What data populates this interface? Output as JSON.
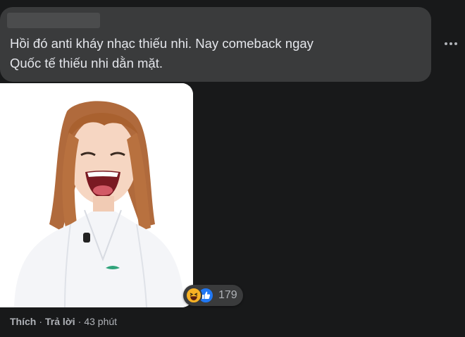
{
  "comment": {
    "text": "Hồi đó anti kháy nhạc thiếu nhi. Nay comeback ngay\nQuốc tế thiếu nhi dằn mặt.",
    "more_icon": "more-horizontal-icon"
  },
  "reactions": {
    "icons": [
      "haha-icon",
      "like-icon"
    ],
    "count": "179"
  },
  "actions": {
    "like_label": "Thích",
    "reply_label": "Trả lời",
    "separator": "·",
    "time": "43 phút"
  },
  "colors": {
    "background": "#18191a",
    "bubble": "#3a3b3c",
    "text": "#e4e6eb",
    "muted": "#b0b3b8",
    "haha": "#f7b125",
    "like": "#2078f4"
  }
}
